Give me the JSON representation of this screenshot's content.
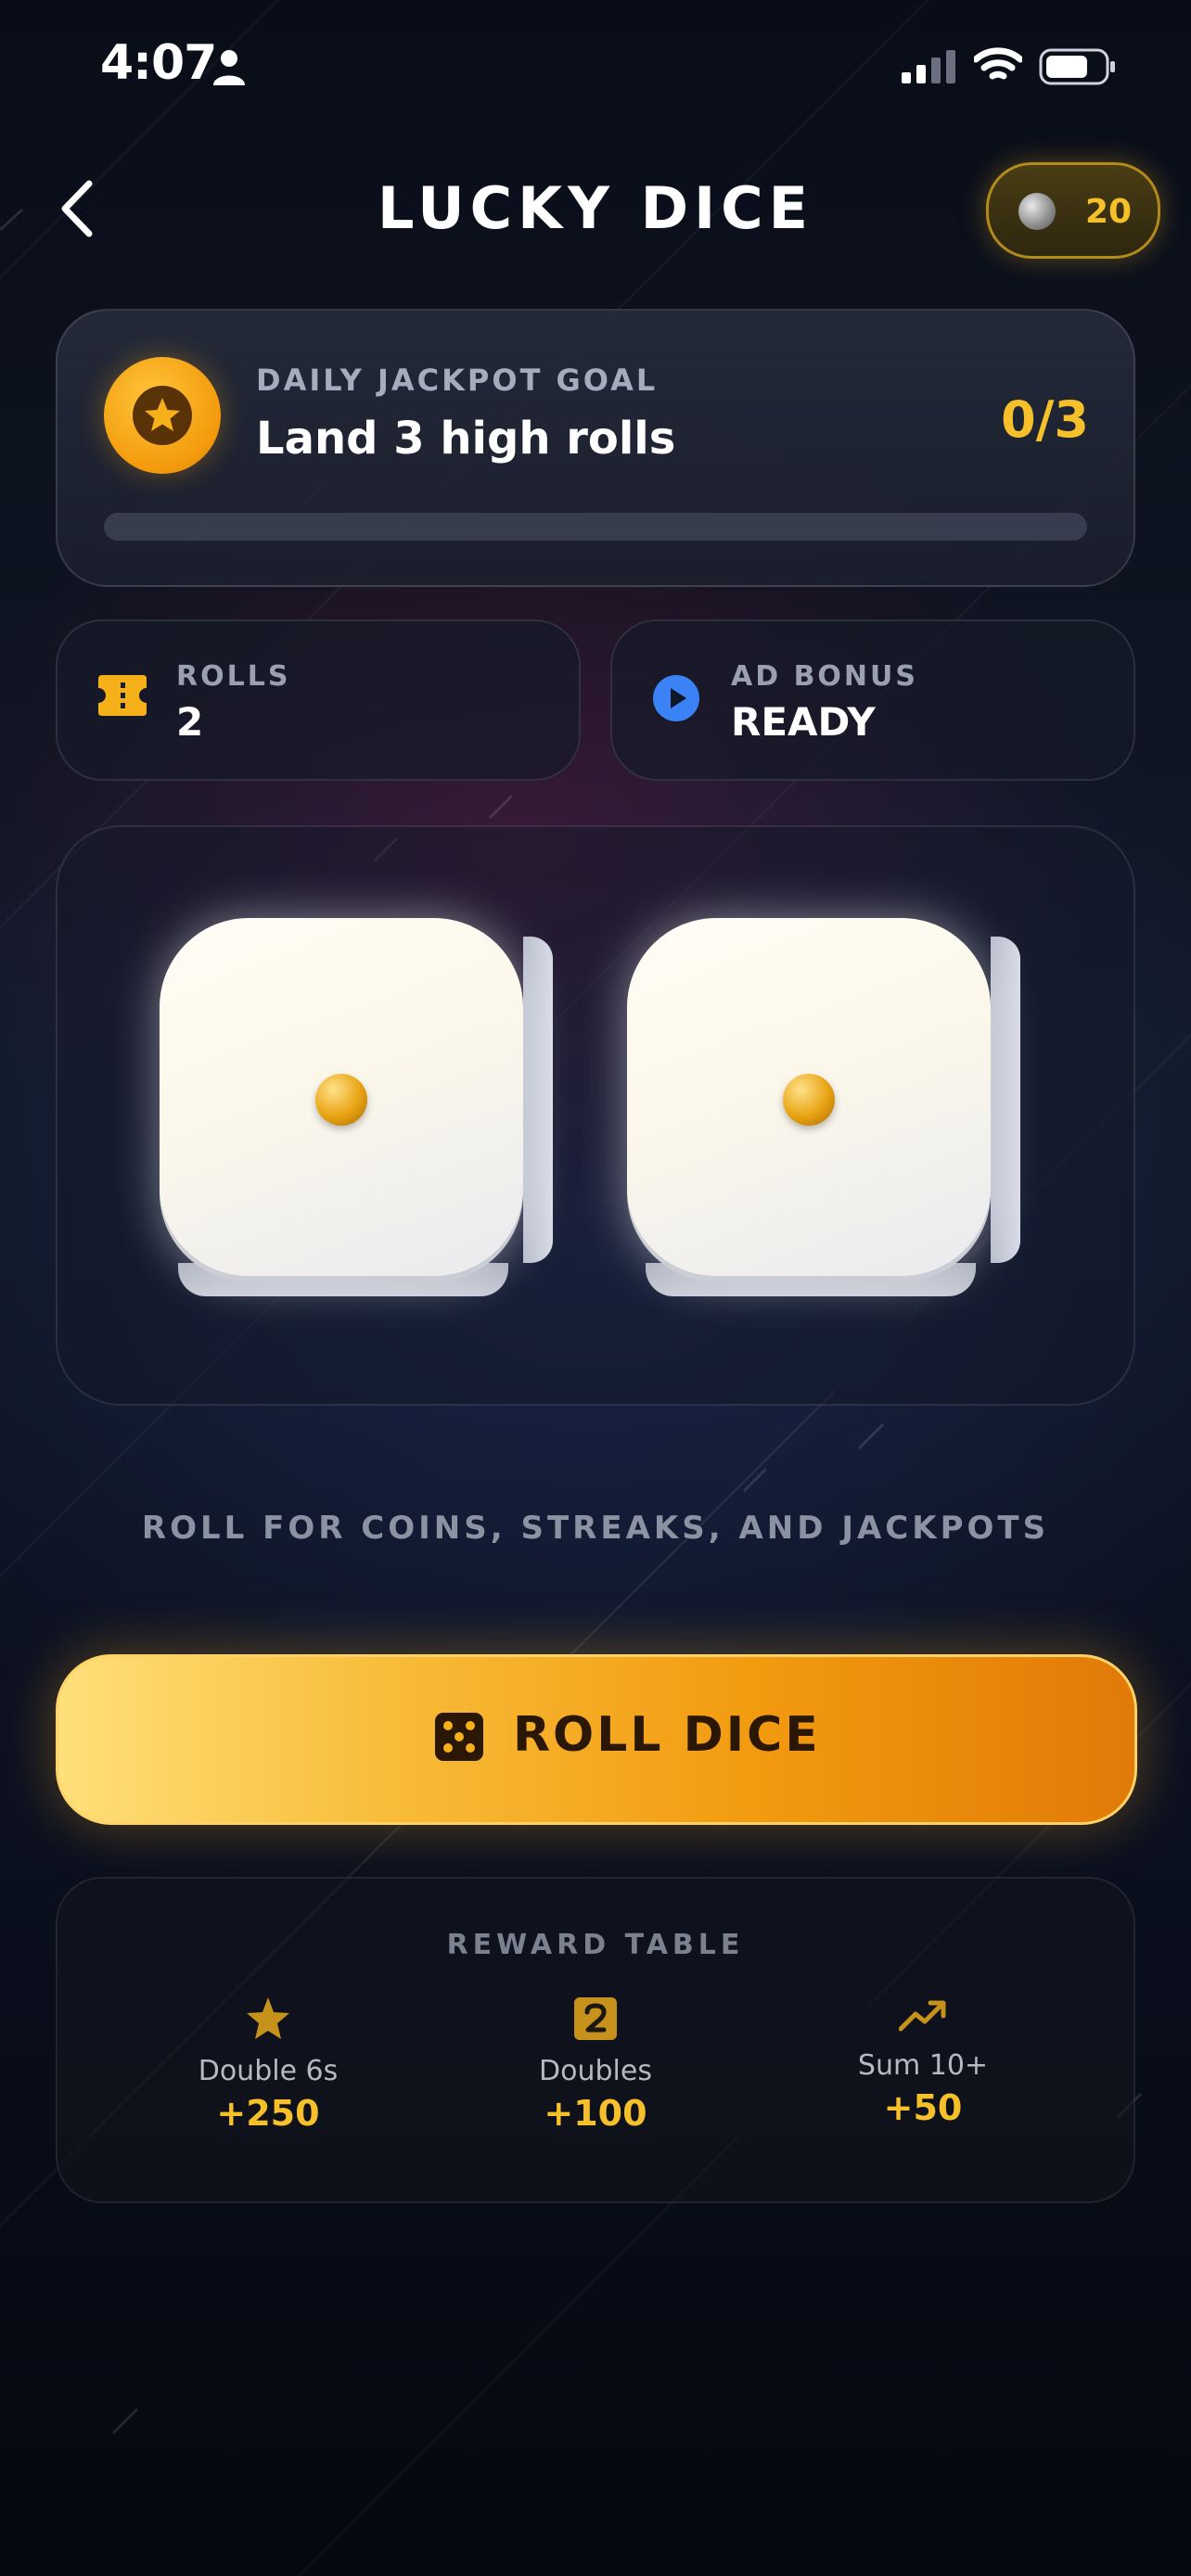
{
  "status_bar": {
    "time": "4:07"
  },
  "header": {
    "title": "LUCKY DICE",
    "coins": "20"
  },
  "jackpot": {
    "label": "DAILY JACKPOT GOAL",
    "goal": "Land 3 high rolls",
    "progress_text": "0/3",
    "progress_fraction": 0
  },
  "stats": {
    "rolls": {
      "label": "ROLLS",
      "value": "2"
    },
    "ad_bonus": {
      "label": "AD BONUS",
      "value": "READY"
    }
  },
  "dice": {
    "die_a_value": 1,
    "die_b_value": 1
  },
  "tagline": "ROLL FOR COINS, STREAKS, AND JACKPOTS",
  "roll_button": {
    "label": "ROLL DICE"
  },
  "reward_table": {
    "title": "REWARD TABLE",
    "items": [
      {
        "icon": "star-icon",
        "name": "Double 6s",
        "value": "+250"
      },
      {
        "icon": "two-badge-icon",
        "name": "Doubles",
        "value": "+100"
      },
      {
        "icon": "trending-up-icon",
        "name": "Sum 10+",
        "value": "+50"
      }
    ]
  },
  "colors": {
    "accent": "#f5c02a",
    "button_start": "#ffe07a",
    "button_end": "#e17a08",
    "ad_blue": "#3b82f6"
  }
}
